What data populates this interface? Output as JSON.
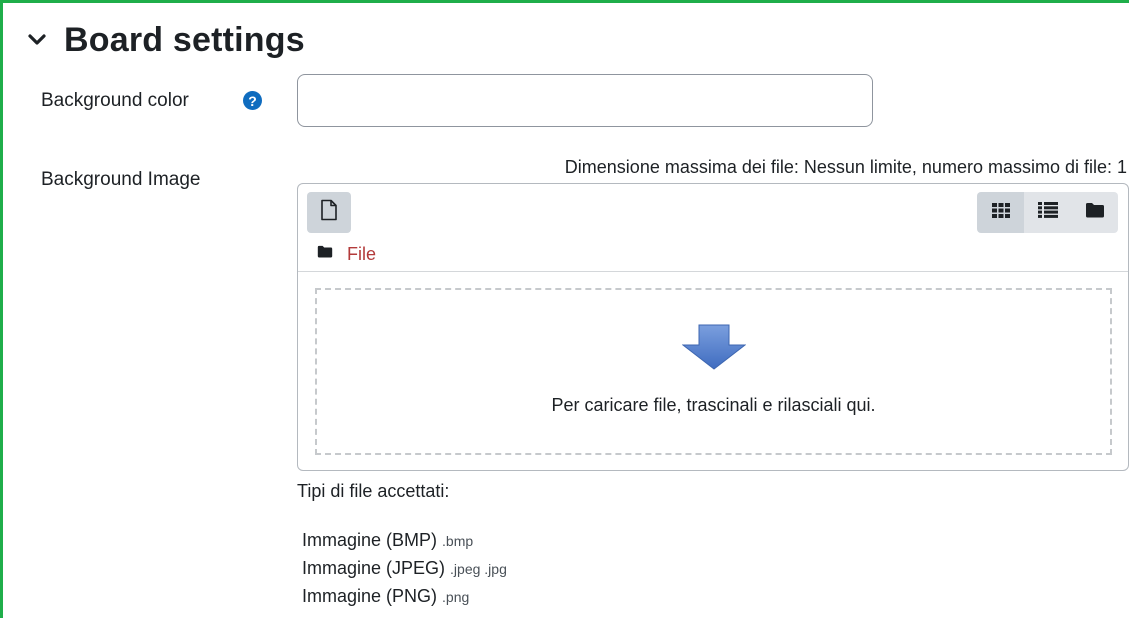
{
  "section": {
    "title": "Board settings",
    "collapse_icon": "chevron-down-icon"
  },
  "fields": {
    "background_color": {
      "label": "Background color",
      "help_icon": "question-circle-icon",
      "value": ""
    },
    "background_image": {
      "label": "Background Image",
      "limits": "Dimensione massima dei file: Nessun limite, numero massimo di file: 1"
    }
  },
  "filemanager": {
    "add_icon": "file-icon",
    "view_icons": [
      "grid-icon",
      "list-icon",
      "folder-icon"
    ],
    "path_icon": "folder-icon",
    "path_label": "File",
    "drop_text": "Per caricare file, trascinali e rilasciali qui.",
    "drop_icon": "down-arrow-icon"
  },
  "accepted": {
    "title": "Tipi di file accettati:",
    "types": [
      {
        "name": "Immagine (BMP)",
        "ext": ".bmp"
      },
      {
        "name": "Immagine (JPEG)",
        "ext": ".jpeg .jpg"
      },
      {
        "name": "Immagine (PNG)",
        "ext": ".png"
      }
    ]
  },
  "colors": {
    "frame": "#1fae4a",
    "help": "#0f6cbf",
    "link": "#b33a3a",
    "arrow": "#4a78c8"
  }
}
